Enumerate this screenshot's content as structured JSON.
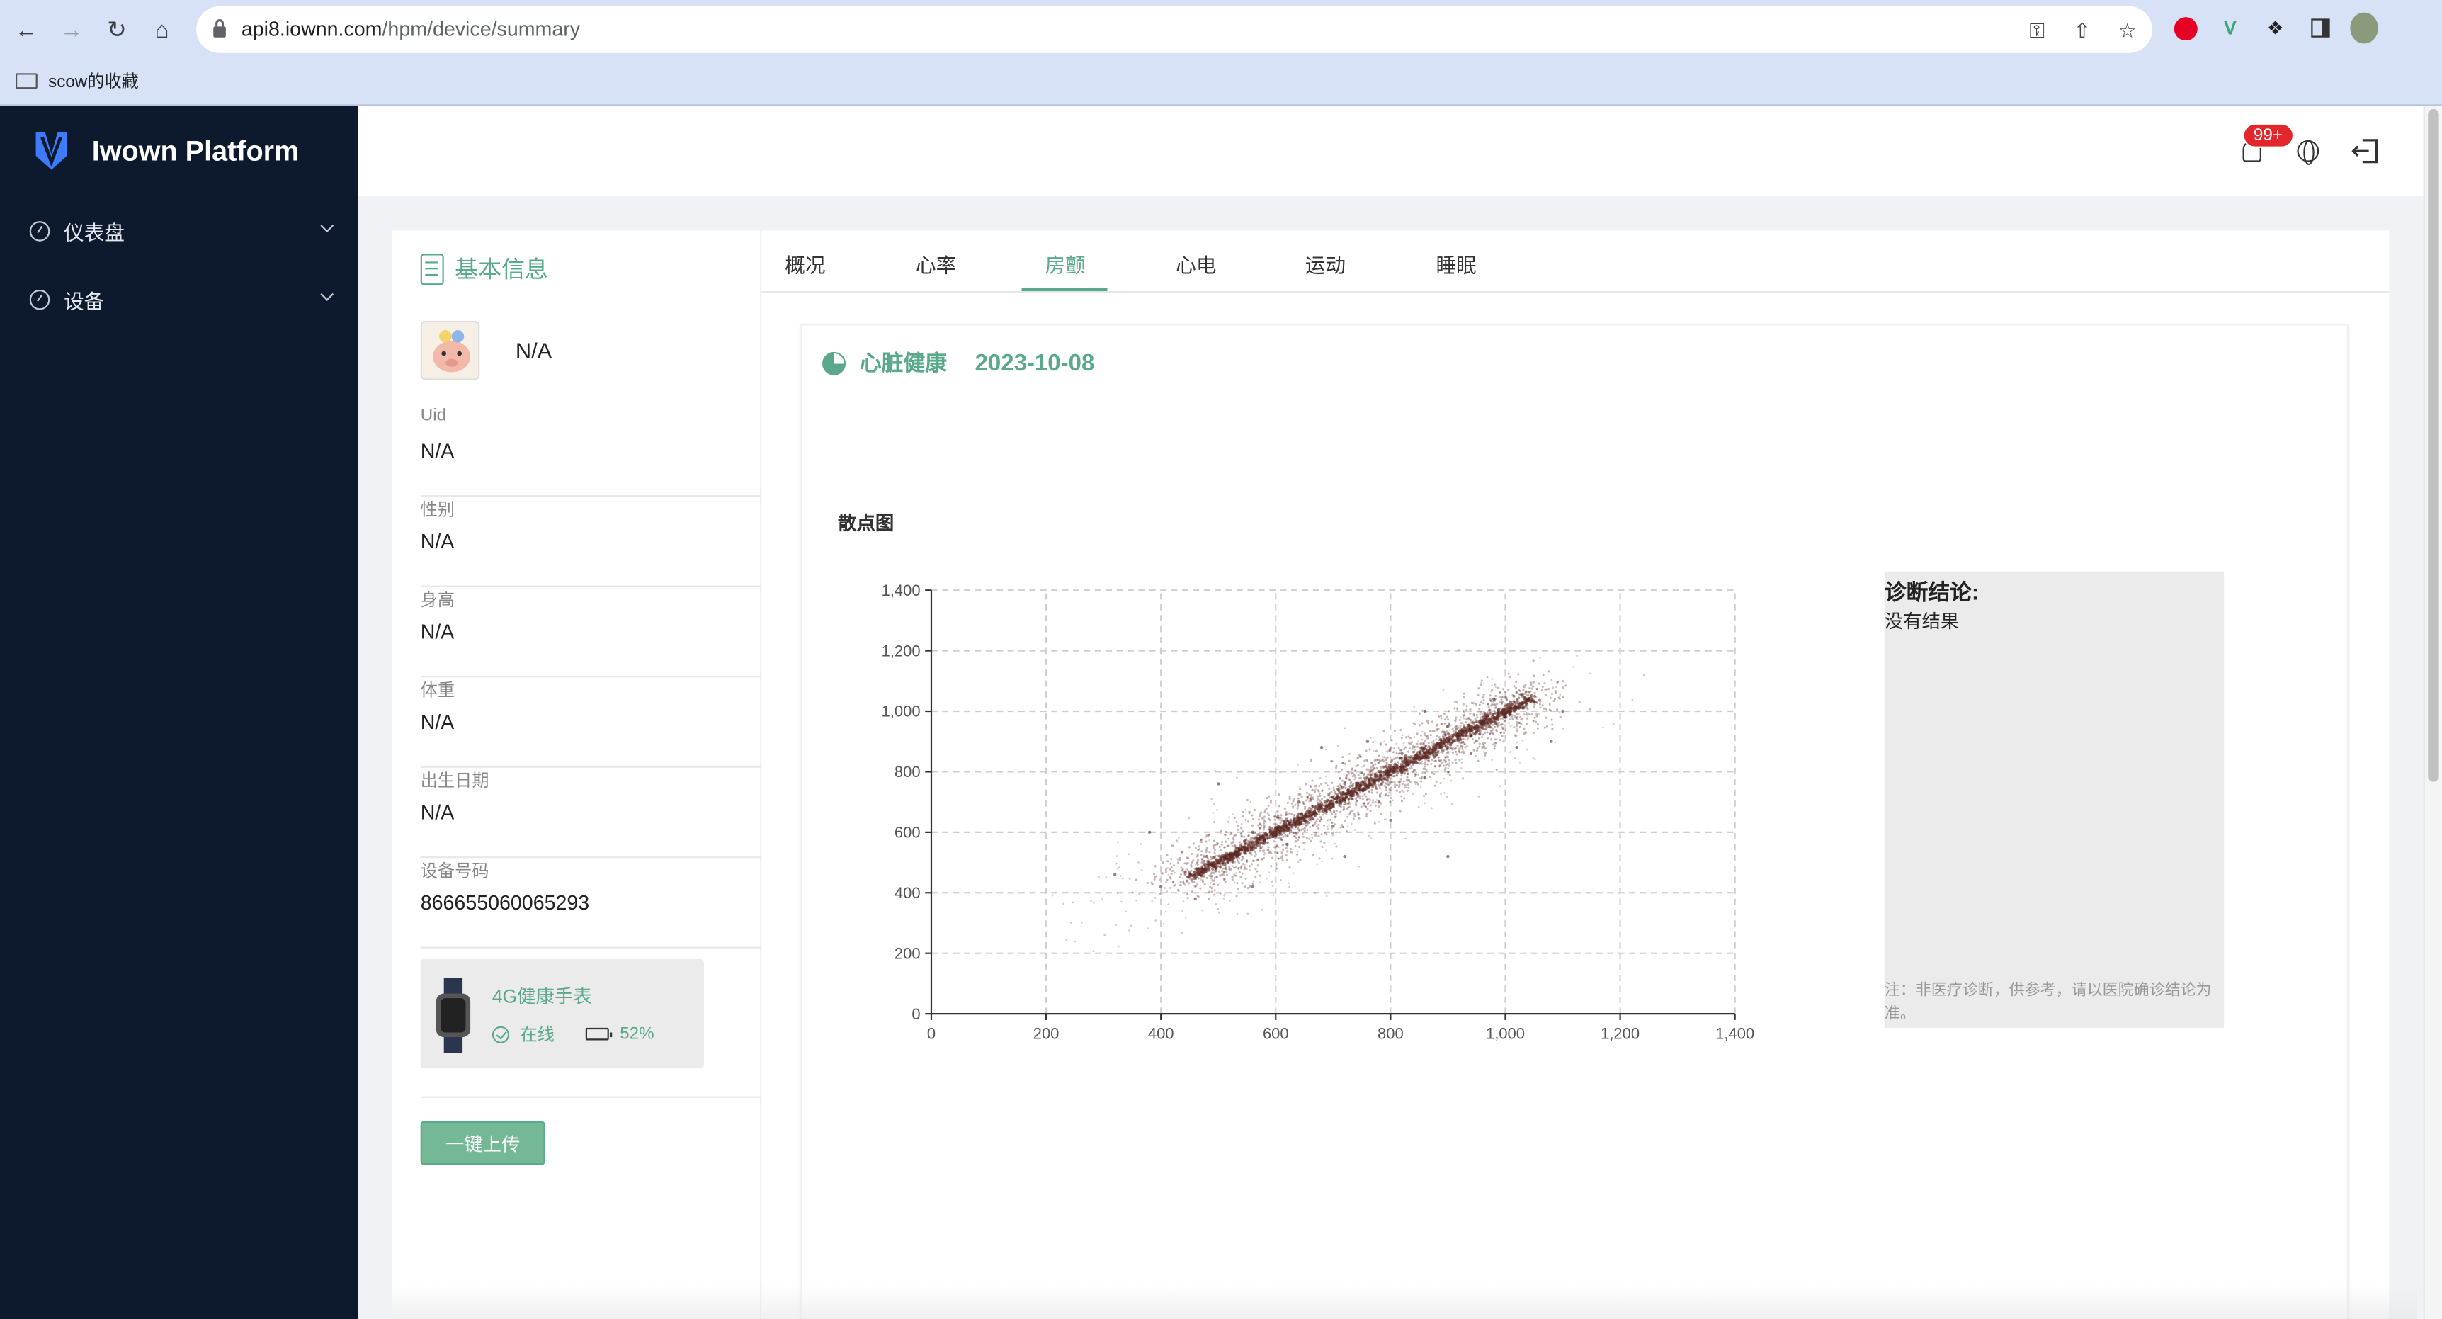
{
  "browser": {
    "url_host": "api8.iownn.com",
    "url_path": "/hpm/device/summary",
    "bookmark": "scow的收藏"
  },
  "app": {
    "title": "Iwown Platform"
  },
  "sidebar": {
    "items": [
      {
        "label": "仪表盘",
        "icon": "dashboard-icon"
      },
      {
        "label": "设备",
        "icon": "dashboard-icon"
      }
    ]
  },
  "header": {
    "notification_count": "99+"
  },
  "basic_info": {
    "title": "基本信息",
    "name": "N/A",
    "fields": [
      {
        "label": "Uid",
        "value": "N/A"
      },
      {
        "label": "性别",
        "value": "N/A"
      },
      {
        "label": "身高",
        "value": "N/A"
      },
      {
        "label": "体重",
        "value": "N/A"
      },
      {
        "label": "出生日期",
        "value": "N/A"
      },
      {
        "label": "设备号码",
        "value": "866655060065293"
      }
    ],
    "device": {
      "name": "4G健康手表",
      "status": "在线",
      "battery": "52%"
    },
    "upload_button": "一键上传"
  },
  "tabs": [
    {
      "label": "概况",
      "active": false
    },
    {
      "label": "心率",
      "active": false
    },
    {
      "label": "房颤",
      "active": true
    },
    {
      "label": "心电",
      "active": false
    },
    {
      "label": "运动",
      "active": false
    },
    {
      "label": "睡眠",
      "active": false
    }
  ],
  "panel": {
    "title": "心脏健康",
    "date": "2023-10-08",
    "chart_title": "散点图"
  },
  "diagnosis": {
    "title": "诊断结论:",
    "result": "没有结果",
    "note": "注：非医疗诊断，供参考，请以医院确诊结论为准。"
  },
  "colors": {
    "accent": "#5aa98a",
    "sidebar_bg": "#0d1a2e",
    "badge": "#e3262c",
    "scatter_point": "#5c2a24"
  },
  "chart_data": {
    "type": "scatter",
    "title": "散点图",
    "xlim": [
      0,
      1400
    ],
    "ylim": [
      0,
      1400
    ],
    "x_ticks": [
      0,
      200,
      400,
      600,
      800,
      1000,
      1200,
      1400
    ],
    "y_ticks": [
      0,
      200,
      400,
      600,
      800,
      1000,
      1200,
      1400
    ],
    "tick_labels": [
      "0",
      "200",
      "400",
      "600",
      "800",
      "1,000",
      "1,200",
      "1,400"
    ],
    "grid": true,
    "series": [
      {
        "description_points": [
          [
            450,
            460
          ],
          [
            500,
            500
          ],
          [
            550,
            540
          ],
          [
            600,
            590
          ],
          [
            650,
            640
          ],
          [
            700,
            690
          ],
          [
            750,
            740
          ],
          [
            800,
            790
          ],
          [
            850,
            840
          ],
          [
            900,
            880
          ],
          [
            950,
            930
          ],
          [
            1000,
            980
          ],
          [
            1050,
            1030
          ],
          [
            480,
            520
          ],
          [
            560,
            600
          ],
          [
            640,
            700
          ],
          [
            720,
            760
          ],
          [
            820,
            860
          ],
          [
            900,
            950
          ],
          [
            980,
            1040
          ],
          [
            620,
            560
          ],
          [
            700,
            620
          ],
          [
            780,
            700
          ],
          [
            860,
            780
          ],
          [
            940,
            860
          ],
          [
            380,
            600
          ],
          [
            320,
            460
          ],
          [
            1080,
            900
          ],
          [
            1100,
            1000
          ],
          [
            560,
            420
          ],
          [
            500,
            760
          ],
          [
            900,
            520
          ],
          [
            400,
            420
          ],
          [
            460,
            380
          ],
          [
            760,
            900
          ],
          [
            680,
            880
          ],
          [
            1020,
            880
          ],
          [
            860,
            1000
          ],
          [
            720,
            520
          ],
          [
            800,
            640
          ]
        ]
      }
    ]
  }
}
